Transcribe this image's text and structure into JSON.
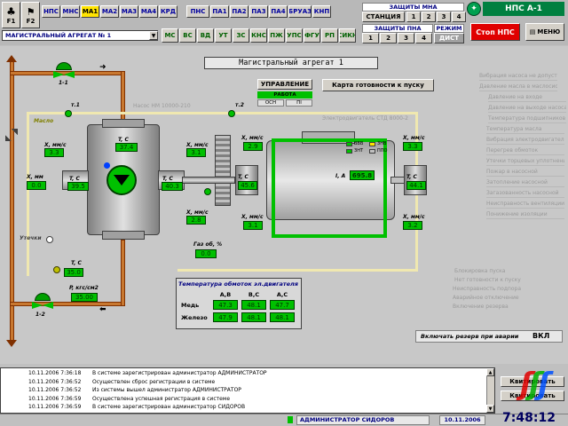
{
  "toolbar": {
    "f1": "F1",
    "f2": "F2",
    "row1": [
      "НПС",
      "МНС",
      "МА1",
      "МА2",
      "МА3",
      "МА4",
      "КРД",
      "ПНС",
      "ПА1",
      "ПА2",
      "ПА3",
      "ПА4",
      "БРУАЗ",
      "КНП"
    ],
    "row2": [
      "МС",
      "ВС",
      "ВД",
      "УТ",
      "ЗС",
      "КНС",
      "ПЖ",
      "УПС",
      "ФГУ",
      "РП",
      "СИКН"
    ],
    "unit_select": "МАГИСТРАЛЬНЫЙ АГРЕГАТ № 1",
    "mna_title": "ЗАЩИТЫ МНА",
    "station": "СТАНЦИЯ",
    "mna_nums": [
      "1",
      "2",
      "3",
      "4"
    ],
    "pna_title": "ЗАЩИТЫ ПНА",
    "mode_title": "РЕЖИМ",
    "pna_nums": [
      "1",
      "2",
      "3",
      "4"
    ],
    "mode_value": "ДИСТ",
    "nps_label": "НПС А-1",
    "stop_label": "Стоп НПС",
    "menu_label": "МЕНЮ"
  },
  "main": {
    "title": "Магистральный агрегат 1",
    "control": {
      "title": "УПРАВЛЕНИЕ",
      "status": "РАБОТА",
      "osn": "ОСН",
      "pi": "ПI"
    },
    "readiness": "Карта готовности к пуску",
    "pump_model": "Насос НМ 10000-210",
    "motor_model": "Электродвигатель СТД 8000-2",
    "t1": "т.1",
    "t2": "т.2",
    "oil": "Масло",
    "leak": "Утечки",
    "valve1": "1-1",
    "valve2": "1-2",
    "lbl_tc": "T, C",
    "lbl_xmm": "X, мм/с",
    "lbl_xmm2": "X, мм",
    "p_case": "P, кгс/см2",
    "gaz": "Газ об, %",
    "motor_i": "I, A",
    "values": {
      "pump_top": "37.4",
      "left_vib": "3.3",
      "left_x": "0.0",
      "left_t": "39.5",
      "right_t": "40.3",
      "right_vib": "3.1",
      "right_vib2": "2.8",
      "oil_t": "35.0",
      "p_case": "35.00",
      "gaz": "0.0",
      "mot_lvib": "2.9",
      "mot_lt": "45.6",
      "mot_lvib2": "3.1",
      "mot_i": "695.8",
      "mot_rvib": "3.3",
      "mot_rt": "44.1",
      "mot_rvib2": "3.2"
    },
    "legend": [
      "ВВВ",
      "ЗНВ",
      "ЗНТ",
      "ППО"
    ],
    "windings": {
      "title": "Температура обмоток эл.двигателя",
      "cols": [
        "А,В",
        "В,С",
        "А,С"
      ],
      "rows": [
        {
          "name": "Медь",
          "values": [
            "47.3",
            "48.1",
            "47.7"
          ]
        },
        {
          "name": "Железо",
          "values": [
            "47.9",
            "48.1",
            "48.1"
          ]
        }
      ]
    },
    "reserve_label": "Включать резерв при аварии",
    "reserve_value": "ВКЛ",
    "faint_right": [
      "Вибрация насоса не допустима",
      "Давление масла в маслосистеме",
      "Давление на входе",
      "Давление на выходе насоса",
      "Температура подшипников",
      "Температура масла",
      "Вибрация электродвигателя",
      "Перегрев обмоток",
      "Утечки торцевых уплотнений",
      "Пожар в насосной",
      "Затопление насосной",
      "Загазованность насосной",
      "Неисправность вентиляции",
      "Понижение изоляции"
    ],
    "faint_bottom": [
      "Блокировка пуска",
      "Нет готовности к пуску",
      "Неисправность подпора",
      "Аварийное отключение",
      "Включение резерва"
    ]
  },
  "log": {
    "rows": [
      {
        "time": "10.11.2006 7:36:18",
        "msg": "В системе зарегистрирован администратор АДМИНИСТРАТОР"
      },
      {
        "time": "10.11.2006 7:36:52",
        "msg": "Осуществлен сброс регистрации в системе"
      },
      {
        "time": "10.11.2006 7:36:52",
        "msg": "Из системы вышел администратор АДМИНИСТРАТОР"
      },
      {
        "time": "10.11.2006 7:36:59",
        "msg": "Осуществлена успешная регистрация в системе"
      },
      {
        "time": "10.11.2006 7:36:59",
        "msg": "В системе зарегистрирован администратор СИДОРОВ"
      }
    ],
    "btn1": "Квитировать",
    "btn2": "Квитировать"
  },
  "status": {
    "user": "АДМИНИСТРАТОР СИДОРОВ",
    "date": "10.11.2006",
    "time": "7:48:12"
  }
}
